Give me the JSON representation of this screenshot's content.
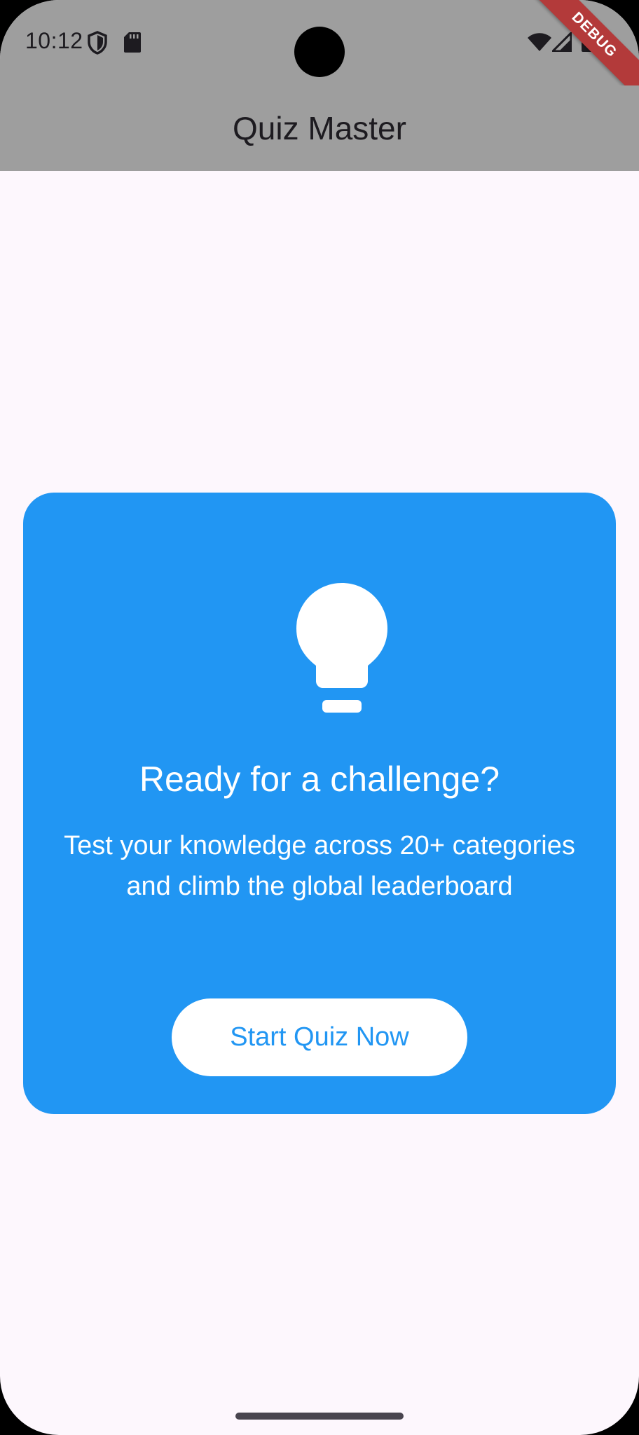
{
  "status_bar": {
    "time": "10:12"
  },
  "app_bar": {
    "title": "Quiz Master"
  },
  "debug_banner": {
    "label": "DEBUG"
  },
  "card": {
    "icon": "lightbulb-icon",
    "title": "Ready for a challenge?",
    "subtitle": "Test your knowledge across 20+ categories and climb the global leaderboard",
    "button_label": "Start Quiz Now"
  },
  "colors": {
    "card_background": "#2196f3",
    "button_text": "#2196f3",
    "app_bar": "#9e9e9e",
    "page_background": "#fdf7fd"
  }
}
